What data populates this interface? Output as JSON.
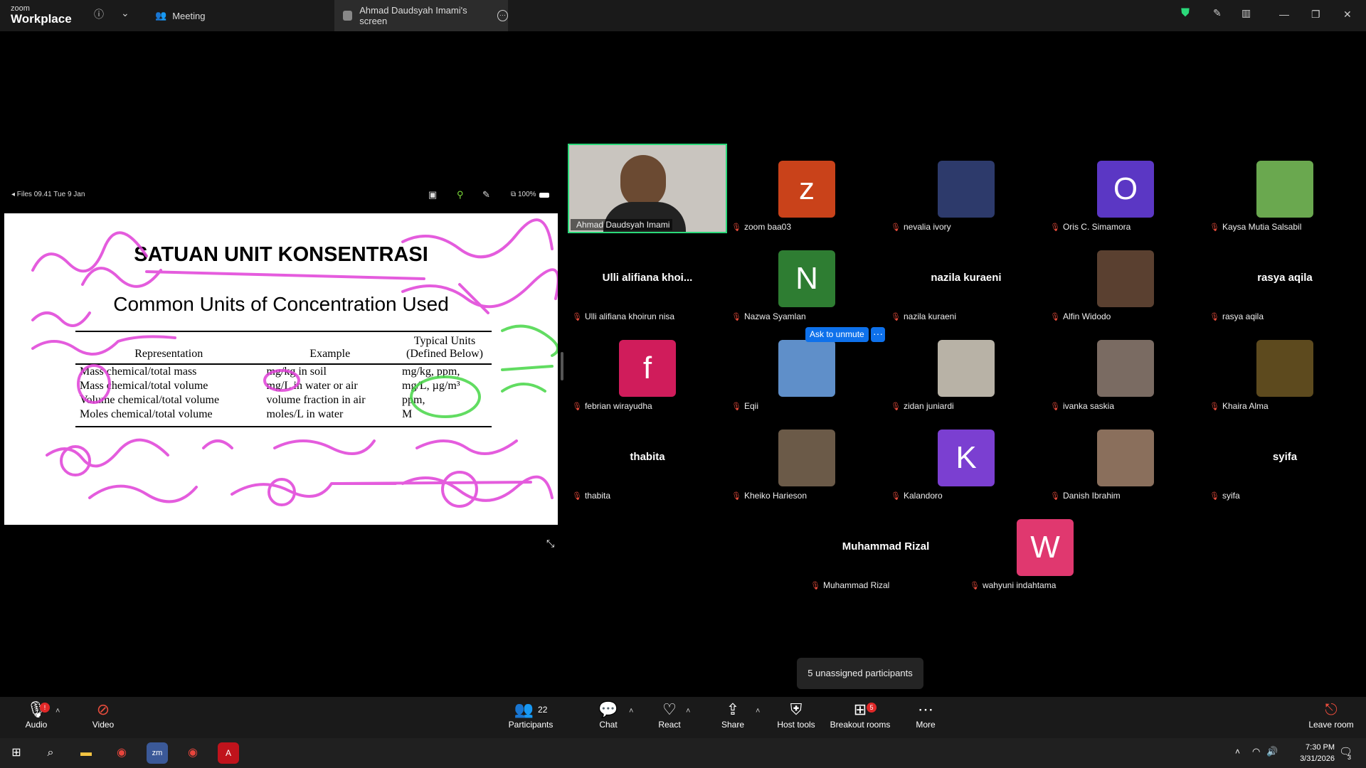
{
  "app": {
    "brand_small": "zoom",
    "brand_big": "Workplace"
  },
  "tabs": [
    {
      "label": "Meeting"
    },
    {
      "label": "Ahmad Daudsyah Imami's screen"
    }
  ],
  "share": {
    "top_left": "◂ Files   09.41   Tue 9 Jan",
    "battery": "100%",
    "slide_title": "SATUAN UNIT KONSENTRASI",
    "slide_subtitle": "Common Units of Concentration Used",
    "table_headers": [
      "Representation",
      "Example",
      "Typical Units (Defined Below)"
    ],
    "table_rows": [
      [
        "Mass chemical/total mass",
        "mg/kg in soil",
        "mg/kg, ppm,"
      ],
      [
        "Mass chemical/total volume",
        "mg/L in water or air",
        "mg/L, µg/m³"
      ],
      [
        "Volume chemical/total volume",
        "volume fraction in air",
        "ppm,"
      ],
      [
        "Moles chemical/total volume",
        "moles/L in water",
        "M"
      ]
    ]
  },
  "participants": [
    {
      "name": "Ahmad Daudsyah Imami",
      "type": "video",
      "active": true
    },
    {
      "name": "zoom baa03",
      "type": "letter",
      "letter": "z",
      "color": "#c9421a"
    },
    {
      "name": "nevalia ivory",
      "type": "photo",
      "color": "#2d3a6b"
    },
    {
      "name": "Oris C. Simamora",
      "type": "letter",
      "letter": "O",
      "color": "#5b37c4"
    },
    {
      "name": "Kaysa Mutia Salsabil",
      "type": "photo",
      "color": "#6aa84f"
    },
    {
      "name": "Ulli alifiana khoirun nisa",
      "type": "text",
      "display": "Ulli  alifiana  khoi..."
    },
    {
      "name": "Nazwa Syamlan",
      "type": "letter",
      "letter": "N",
      "color": "#2e7d32"
    },
    {
      "name": "nazila kuraeni",
      "type": "text",
      "display": "nazila kuraeni"
    },
    {
      "name": "Alfin Widodo",
      "type": "photo",
      "color": "#5a4030"
    },
    {
      "name": "rasya aqila",
      "type": "text",
      "display": "rasya aqila"
    },
    {
      "name": "febrian wirayudha",
      "type": "letter",
      "letter": "f",
      "color": "#d01c5b"
    },
    {
      "name": "Eqii",
      "type": "photo",
      "color": "#5f8fc9"
    },
    {
      "name": "zidan juniardi",
      "type": "photo",
      "color": "#b8b2a6"
    },
    {
      "name": "ivanka saskia",
      "type": "photo",
      "color": "#7a6b62"
    },
    {
      "name": "Khaira Alma",
      "type": "photo",
      "color": "#5d4a1e"
    },
    {
      "name": "thabita",
      "type": "text",
      "display": "thabita"
    },
    {
      "name": "Kheiko Harieson",
      "type": "photo",
      "color": "#6b5a48"
    },
    {
      "name": "Kalandoro",
      "type": "letter",
      "letter": "K",
      "color": "#7b3fd1"
    },
    {
      "name": "Danish Ibrahim",
      "type": "photo",
      "color": "#8a6f5c"
    },
    {
      "name": "syifa",
      "type": "text",
      "display": "syifa"
    },
    {
      "name": "Muhammad Rizal",
      "type": "text",
      "display": "Muhammad Rizal"
    },
    {
      "name": "wahyuni indahtama",
      "type": "letter",
      "letter": "W",
      "color": "#e0386f"
    }
  ],
  "ask_to_unmute": "Ask to unmute",
  "unassigned": "5 unassigned participants",
  "toolbar": {
    "audio": "Audio",
    "video": "Video",
    "participants": "Participants",
    "participants_count": "22",
    "chat": "Chat",
    "react": "React",
    "share": "Share",
    "host_tools": "Host tools",
    "breakout": "Breakout rooms",
    "breakout_badge": "5",
    "more": "More",
    "leave": "Leave room"
  },
  "taskbar": {
    "time": "7:30 PM",
    "date": "3/31/2026",
    "notif": "3"
  },
  "colors": {
    "accent": "#0e71eb",
    "active_border": "#2bd97a",
    "ink": "#e040d8",
    "ink_green": "#46d646"
  }
}
